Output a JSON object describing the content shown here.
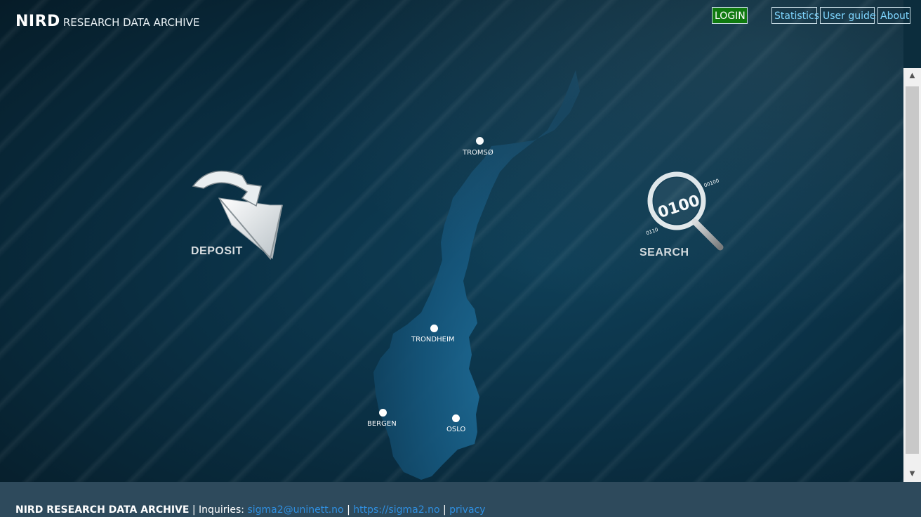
{
  "header": {
    "brand_main": "NIRD",
    "brand_sub": "RESEARCH DATA ARCHIVE"
  },
  "nav": {
    "login": "LOGIN",
    "statistics": "Statistics",
    "user_guide": "User guide",
    "about": "About"
  },
  "actions": {
    "deposit": "DEPOSIT",
    "search": "SEARCH",
    "search_binary_main": "0100",
    "search_binary_left": "0110",
    "search_binary_right": "00100"
  },
  "map": {
    "cities": [
      "TROMSØ",
      "TRONDHEIM",
      "BERGEN",
      "OSLO"
    ]
  },
  "footer": {
    "title": "NIRD RESEARCH DATA ARCHIVE",
    "sep1": " | Inquiries: ",
    "email": "sigma2@uninett.no",
    "sep2": " | ",
    "site": "https://sigma2.no",
    "sep3": " | ",
    "privacy": "privacy"
  },
  "colors": {
    "login_bg": "#107a10",
    "nav_text": "#7fd6ff",
    "footer_bg": "#2e4a5c",
    "link": "#2f8fe0",
    "background": "#0b3247"
  }
}
